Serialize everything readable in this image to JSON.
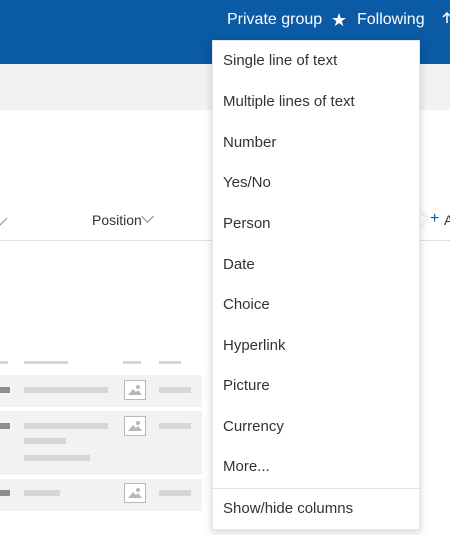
{
  "header": {
    "group_label": "Private group",
    "following_label": "Following",
    "star_glyph": "★",
    "bg_color": "#0b5aa6"
  },
  "list": {
    "column_position": "Position",
    "add_column_glyph": "+",
    "add_column_partial_text": "A"
  },
  "menu": {
    "items": [
      "Single line of text",
      "Multiple lines of text",
      "Number",
      "Yes/No",
      "Person",
      "Date",
      "Choice",
      "Hyperlink",
      "Picture",
      "Currency",
      "More..."
    ],
    "footer_item": "Show/hide columns"
  }
}
